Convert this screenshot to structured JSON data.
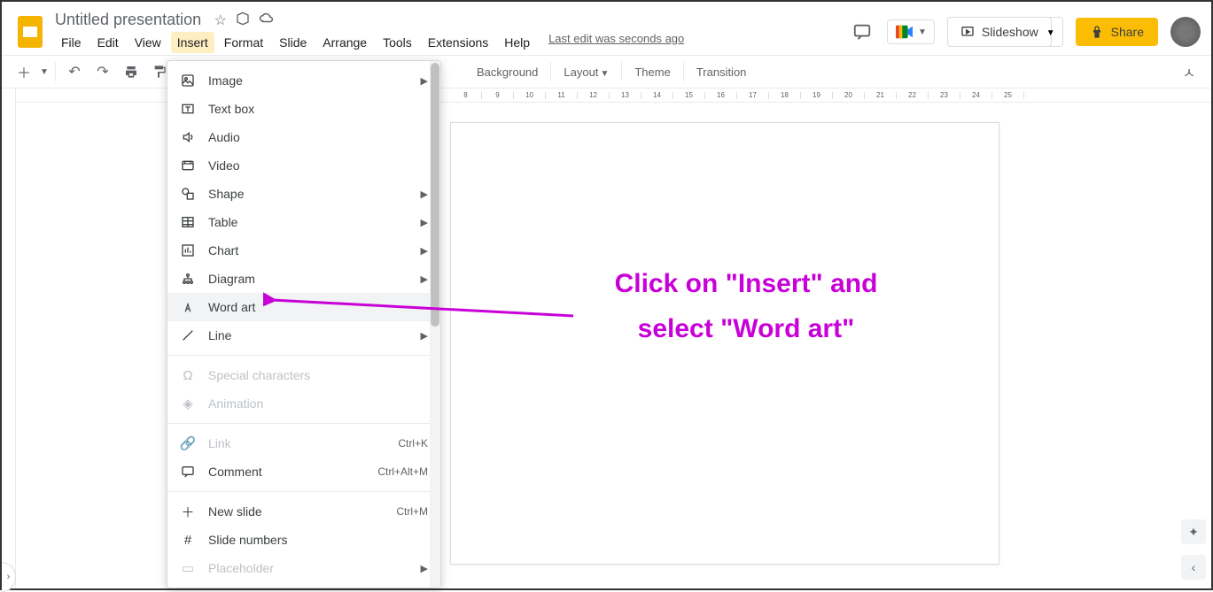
{
  "header": {
    "doc_title": "Untitled presentation",
    "last_edit": "Last edit was seconds ago"
  },
  "menubar": {
    "items": [
      "File",
      "Edit",
      "View",
      "Insert",
      "Format",
      "Slide",
      "Arrange",
      "Tools",
      "Extensions",
      "Help"
    ],
    "active_index": 3
  },
  "header_actions": {
    "slideshow": "Slideshow",
    "share": "Share"
  },
  "toolbar_extras": {
    "background": "Background",
    "layout": "Layout",
    "theme": "Theme",
    "transition": "Transition"
  },
  "dropdown": {
    "groups": [
      [
        {
          "icon": "image",
          "label": "Image",
          "arrow": true
        },
        {
          "icon": "textbox",
          "label": "Text box"
        },
        {
          "icon": "audio",
          "label": "Audio"
        },
        {
          "icon": "video",
          "label": "Video"
        },
        {
          "icon": "shape",
          "label": "Shape",
          "arrow": true
        },
        {
          "icon": "table",
          "label": "Table",
          "arrow": true
        },
        {
          "icon": "chart",
          "label": "Chart",
          "arrow": true
        },
        {
          "icon": "diagram",
          "label": "Diagram",
          "arrow": true
        },
        {
          "icon": "wordart",
          "label": "Word art",
          "hover": true
        },
        {
          "icon": "line",
          "label": "Line",
          "arrow": true
        }
      ],
      [
        {
          "icon": "special",
          "label": "Special characters",
          "disabled": true
        },
        {
          "icon": "anim",
          "label": "Animation",
          "disabled": true
        }
      ],
      [
        {
          "icon": "link",
          "label": "Link",
          "shortcut": "Ctrl+K",
          "disabled": true
        },
        {
          "icon": "comment",
          "label": "Comment",
          "shortcut": "Ctrl+Alt+M"
        }
      ],
      [
        {
          "icon": "newslide",
          "label": "New slide",
          "shortcut": "Ctrl+M"
        },
        {
          "icon": "slidenum",
          "label": "Slide numbers"
        },
        {
          "icon": "placeholder",
          "label": "Placeholder",
          "arrow": true,
          "disabled": true
        }
      ]
    ]
  },
  "ruler_ticks": [
    "8",
    "9",
    "10",
    "11",
    "12",
    "13",
    "14",
    "15",
    "16",
    "17",
    "18",
    "19",
    "20",
    "21",
    "22",
    "23",
    "24",
    "25"
  ],
  "annotation": {
    "line1": "Click on \"Insert\" and",
    "line2": "select \"Word art\""
  }
}
